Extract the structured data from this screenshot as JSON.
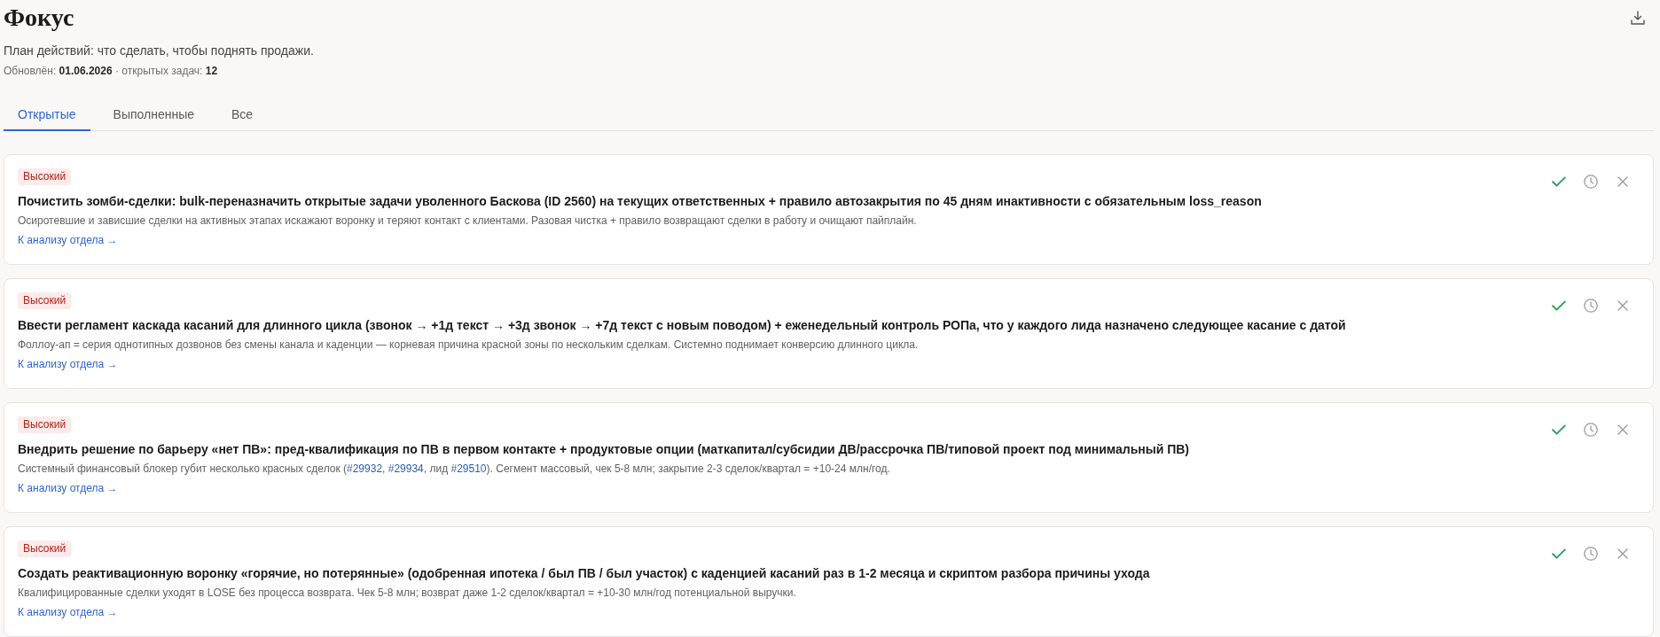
{
  "header": {
    "title": "Фокус",
    "subtitle": "План действий: что сделать, чтобы поднять продажи.",
    "meta": "Обновлён: **01.06.2026** · открытых задач: **12**"
  },
  "tabs": [
    {
      "label": "Открытые",
      "selected": true
    },
    {
      "label": "Выполненные",
      "selected": false
    },
    {
      "label": "Все",
      "selected": false
    }
  ],
  "tasks": [
    {
      "priority": {
        "label": "Высокий",
        "kind": "high"
      },
      "title": "Почистить зомби-сделки: bulk-переназначить открытые задачи уволенного Баскова (ID 2560) на текущих ответственных + правило автозакрытия по 45 дням инактивности с обязательным loss_reason",
      "description": [
        {
          "kind": "text",
          "text": "Осиротевшие и зависшие сделки на активных этапах искажают воронку и теряют контакт с клиентами. Разовая чистка + правило возвращают сделки в работу и очищают пайплайн."
        }
      ],
      "link": "К анализу отдела →"
    },
    {
      "priority": {
        "label": "Высокий",
        "kind": "high"
      },
      "title": "Ввести регламент каскада касаний для длинного цикла (звонок → +1д текст → +3д звонок → +7д текст с новым поводом) + еженедельный контроль РОПа, что у каждого лида назначено следующее касание с датой",
      "description": [
        {
          "kind": "text",
          "text": "Фоллоу-ап = серия однотипных дозвонов без смены канала и каденции — корневая причина красной зоны по нескольким сделкам. Системно поднимает конверсию длинного цикла."
        }
      ],
      "link": "К анализу отдела →"
    },
    {
      "priority": {
        "label": "Высокий",
        "kind": "high"
      },
      "title": "Внедрить решение по барьеру «нет ПВ»: пред-квалификация по ПВ в первом контакте + продуктовые опции (маткапитал/субсидии ДВ/рассрочка ПВ/типовой проект под минимальный ПВ)",
      "description": [
        {
          "kind": "text",
          "text": "Системный финансовый блокер губит несколько красных сделок ("
        },
        {
          "kind": "link",
          "text": "#29932"
        },
        {
          "kind": "text",
          "text": ", "
        },
        {
          "kind": "link",
          "text": "#29934"
        },
        {
          "kind": "text",
          "text": ", лид "
        },
        {
          "kind": "link",
          "text": "#29510"
        },
        {
          "kind": "text",
          "text": "). Сегмент массовый, чек 5-8 млн; закрытие 2-3 сделок/квартал = +10-24 млн/год."
        }
      ],
      "link": "К анализу отдела →"
    },
    {
      "priority": {
        "label": "Высокий",
        "kind": "high"
      },
      "title": "Создать реактивационную воронку «горячие, но потерянные» (одобренная ипотека / был ПВ / был участок) с каденцией касаний раз в 1-2 месяца и скриптом разбора причины ухода",
      "description": [
        {
          "kind": "text",
          "text": "Квалифицированные сделки уходят в LOSE без процесса возврата. Чек 5-8 млн; возврат даже 1-2 сделок/квартал = +10-30 млн/год потенциальной выручки."
        }
      ],
      "link": "К анализу отдела →"
    }
  ]
}
